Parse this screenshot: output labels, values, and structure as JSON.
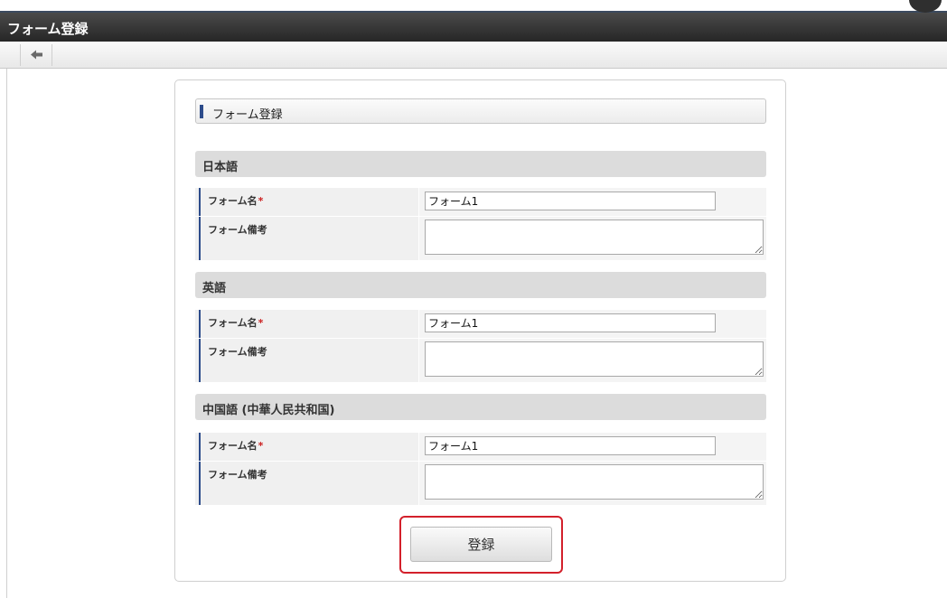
{
  "window": {
    "title": "フォーム登録"
  },
  "toolbar": {
    "back_icon": "arrow-left-icon"
  },
  "form": {
    "section_title": "フォーム登録",
    "languages": [
      {
        "name": "日本語",
        "fields": [
          {
            "label": "フォーム名",
            "required_mark": "*",
            "value": "フォーム1"
          },
          {
            "label": "フォーム備考",
            "value": ""
          }
        ]
      },
      {
        "name": "英語",
        "fields": [
          {
            "label": "フォーム名",
            "required_mark": "*",
            "value": "フォーム1"
          },
          {
            "label": "フォーム備考",
            "value": ""
          }
        ]
      },
      {
        "name": "中国語 (中華人民共和国)",
        "fields": [
          {
            "label": "フォーム名",
            "required_mark": "*",
            "value": "フォーム1"
          },
          {
            "label": "フォーム備考",
            "value": ""
          }
        ]
      }
    ],
    "submit_label": "登録"
  },
  "colors": {
    "accent": "#2d4c8b",
    "highlight": "#d3202b",
    "required": "#cc2222"
  }
}
